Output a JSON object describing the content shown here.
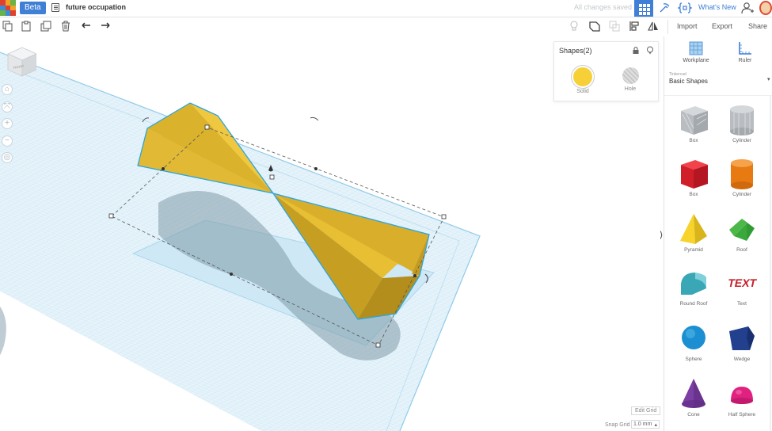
{
  "app": {
    "beta_label": "Beta",
    "document_title": "future occupation",
    "save_status": "All changes saved",
    "whats_new": "What's New",
    "icons": [
      "app-logo-icon",
      "document-icon",
      "grid-view-icon",
      "pickaxe-icon",
      "code-blocks-icon",
      "account-icon",
      "avatar"
    ]
  },
  "toolbar": {
    "left_icons": [
      "copy-icon",
      "paste-icon",
      "duplicate-icon",
      "delete-icon",
      "undo-icon",
      "redo-icon"
    ],
    "right_icons": [
      "light-bulb-icon",
      "group-icon",
      "ungroup-icon",
      "align-icon",
      "mirror-icon"
    ],
    "import_label": "Import",
    "export_label": "Export",
    "share_label": "Share"
  },
  "viewport": {
    "viewcube_label": "FRONT",
    "nav_icons": [
      "home-icon",
      "fit-icon",
      "zoom-in-icon",
      "zoom-out-icon",
      "perspective-icon"
    ],
    "edit_grid_label": "Edit Grid",
    "snap_grid_label": "Snap Grid",
    "snap_grid_value": "1.0 mm",
    "grid_color": "#7fc4e6",
    "shape_color": "#e5b92a",
    "selection_outline_color": "#28a6e0"
  },
  "inspector": {
    "title": "Shapes(2)",
    "icons": [
      "lock-icon",
      "light-bulb-icon"
    ],
    "solid_label": "Solid",
    "hole_label": "Hole",
    "solid_color": "#f7d038"
  },
  "panel": {
    "workplane_label": "Workplane",
    "ruler_label": "Ruler",
    "library_source": "Tinkercad",
    "library_name": "Basic Shapes",
    "shapes": [
      {
        "label": "Box",
        "kind": "box-hole"
      },
      {
        "label": "Cylinder",
        "kind": "cylinder-hole"
      },
      {
        "label": "Box",
        "kind": "box"
      },
      {
        "label": "Cylinder",
        "kind": "cylinder"
      },
      {
        "label": "Pyramid",
        "kind": "pyramid"
      },
      {
        "label": "Roof",
        "kind": "roof"
      },
      {
        "label": "Round Roof",
        "kind": "round-roof"
      },
      {
        "label": "Text",
        "kind": "text"
      },
      {
        "label": "Sphere",
        "kind": "sphere"
      },
      {
        "label": "Wedge",
        "kind": "wedge"
      },
      {
        "label": "Cone",
        "kind": "cone"
      },
      {
        "label": "Half Sphere",
        "kind": "half-sphere"
      }
    ],
    "text_shape_glyphs": "TEXT"
  }
}
